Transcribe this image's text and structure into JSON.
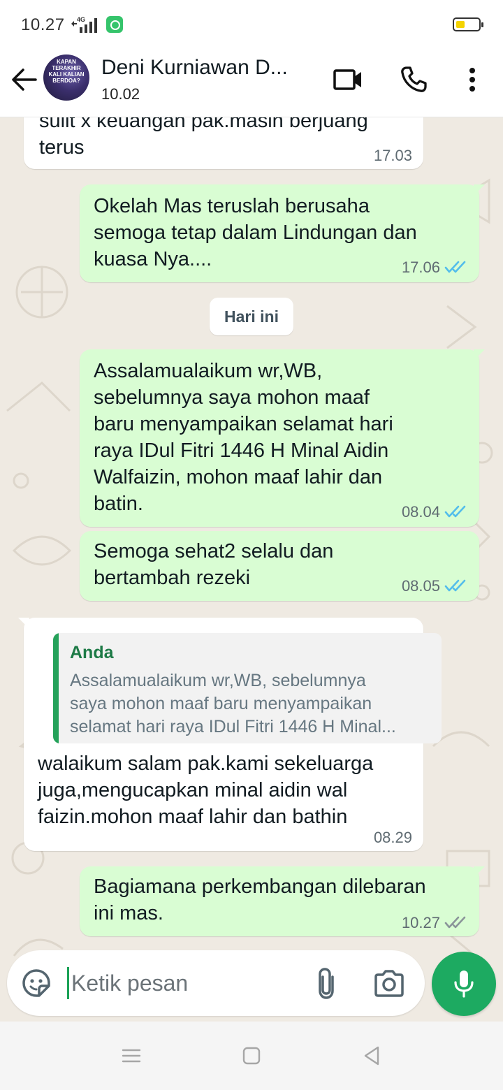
{
  "status_bar": {
    "time": "10.27",
    "network": "4G"
  },
  "header": {
    "contact_name": "Deni Kurniawan D...",
    "subtitle": "10.02",
    "avatar_text": "KAPAN TERAKHIR KALI KALIAN BERDOA?",
    "icons": [
      "back-arrow-icon",
      "video-call-icon",
      "voice-call-icon",
      "more-vert-icon"
    ]
  },
  "messages": [
    {
      "direction": "incoming",
      "text_lines": [
        "sulit x keuangan pak.masih berjuang",
        "terus"
      ],
      "time": "17.03"
    },
    {
      "direction": "outgoing",
      "text_lines": [
        "Okelah Mas teruslah berusaha",
        "semoga tetap dalam Lindungan dan",
        "kuasa Nya...."
      ],
      "time": "17.06",
      "status": "read"
    },
    {
      "direction": "outgoing",
      "text_lines": [
        "Assalamualaikum wr,WB,",
        "sebelumnya saya mohon maaf",
        "baru menyampaikan selamat hari",
        "raya IDul Fitri 1446 H Minal Aidin",
        "Walfaizin, mohon maaf lahir dan",
        "batin."
      ],
      "time": "08.04",
      "status": "read"
    },
    {
      "direction": "outgoing",
      "text_lines": [
        "Semoga sehat2 selalu dan",
        "bertambah rezeki"
      ],
      "time": "08.05",
      "status": "read"
    },
    {
      "direction": "incoming",
      "quote": {
        "author": "Anda",
        "text_lines": [
          "Assalamualaikum wr,WB, sebelumnya",
          "saya mohon maaf baru menyampaikan",
          "selamat hari raya IDul Fitri 1446 H Minal..."
        ]
      },
      "text_lines": [
        "walaikum salam pak.kami sekeluarga",
        "juga,mengucapkan minal aidin wal",
        "faizin.mohon maaf lahir dan bathin"
      ],
      "time": "08.29"
    },
    {
      "direction": "outgoing",
      "text_lines": [
        "Bagiamana perkembangan dilebaran",
        "ini mas."
      ],
      "time": "10.27",
      "status": "delivered"
    }
  ],
  "date_separator": "Hari ini",
  "input": {
    "placeholder": "Ketik pesan"
  },
  "colors": {
    "outgoing_bubble": "#d9fdd3",
    "incoming_bubble": "#ffffff",
    "chat_background": "#efeae2",
    "read_tick": "#53bdeb",
    "accent_green": "#1daa61"
  }
}
